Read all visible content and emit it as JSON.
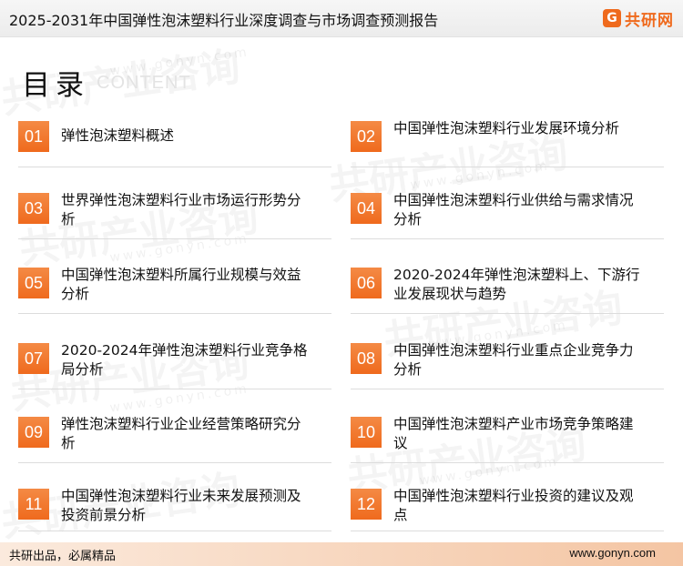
{
  "header": {
    "title": "2025-2031年中国弹性泡沫塑料行业深度调查与市场调查预测报告",
    "logo_mark": "G",
    "logo_text": "共研网"
  },
  "toc": {
    "heading": "目录",
    "heading_en": "CONTENT",
    "items": [
      {
        "num": "01",
        "label": "弹性泡沫塑料概述"
      },
      {
        "num": "02",
        "label": "中国弹性泡沫塑料行业发展环境分析"
      },
      {
        "num": "03",
        "label": "世界弹性泡沫塑料行业市场运行形势分析"
      },
      {
        "num": "04",
        "label": "中国弹性泡沫塑料行业供给与需求情况分析"
      },
      {
        "num": "05",
        "label": "中国弹性泡沫塑料所属行业规模与效益分析"
      },
      {
        "num": "06",
        "label": "2020-2024年弹性泡沫塑料上、下游行业发展现状与趋势"
      },
      {
        "num": "07",
        "label": "2020-2024年弹性泡沫塑料行业竞争格局分析"
      },
      {
        "num": "08",
        "label": "中国弹性泡沫塑料行业重点企业竞争力分析"
      },
      {
        "num": "09",
        "label": "弹性泡沫塑料行业企业经营策略研究分析"
      },
      {
        "num": "10",
        "label": "中国弹性泡沫塑料产业市场竞争策略建议"
      },
      {
        "num": "11",
        "label": "中国弹性泡沫塑料行业未来发展预测及投资前景分析"
      },
      {
        "num": "12",
        "label": "中国弹性泡沫塑料行业投资的建议及观点"
      }
    ]
  },
  "watermark": {
    "brand": "共研产业咨询",
    "url": "www.gonyn.com"
  },
  "footer": {
    "slogan": "共研出品，必属精品",
    "website": "www.gonyn.com"
  },
  "colors": {
    "accent": "#ef6a1d",
    "footer_gradient_end": "#f4c5a3"
  }
}
